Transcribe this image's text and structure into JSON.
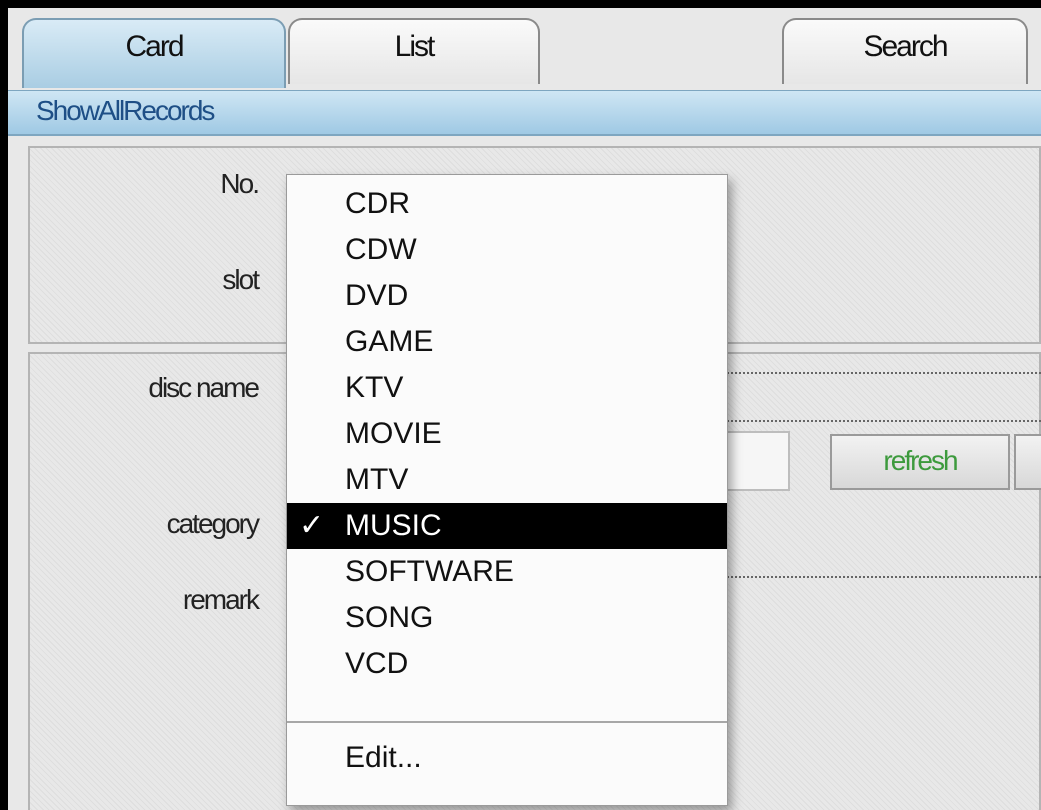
{
  "tabs": [
    {
      "label": "Card",
      "active": true
    },
    {
      "label": "List",
      "active": false
    },
    {
      "label": "Search",
      "active": false
    }
  ],
  "toolbar": {
    "show_all_label": "ShowAllRecords"
  },
  "form": {
    "labels": {
      "no": "No.",
      "slot": "slot",
      "disc_name": "disc name",
      "category": "category",
      "remark": "remark"
    },
    "refresh_label": "refresh"
  },
  "category_menu": {
    "items": [
      "CDR",
      "CDW",
      "DVD",
      "GAME",
      "KTV",
      "MOVIE",
      "MTV",
      "MUSIC",
      "SOFTWARE",
      "SONG",
      "VCD"
    ],
    "selected": "MUSIC",
    "check_glyph": "✓",
    "edit_label": "Edit..."
  },
  "colors": {
    "active_tab": "#a9cde3",
    "link_text": "#1e4f86",
    "refresh_text": "#3d9a3d",
    "menu_highlight": "#000000"
  }
}
